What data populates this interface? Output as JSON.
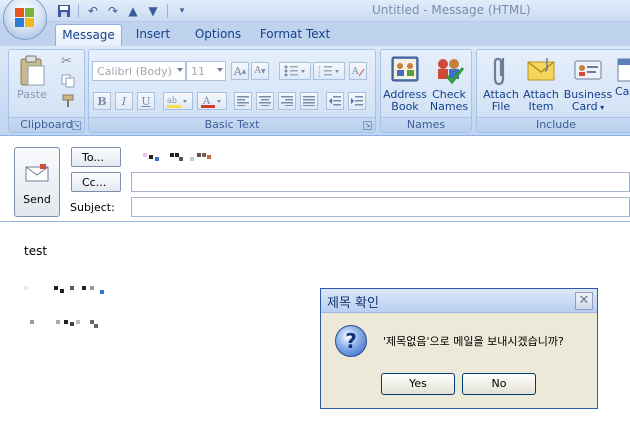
{
  "window": {
    "title": "Untitled - Message (HTML)"
  },
  "quick_access": {
    "icons": [
      "save-icon",
      "undo-icon",
      "redo-icon",
      "up-arrow-icon",
      "down-arrow-icon",
      "customize-icon"
    ]
  },
  "tabs": [
    {
      "label": "Message",
      "active": true
    },
    {
      "label": "Insert",
      "active": false
    },
    {
      "label": "Options",
      "active": false
    },
    {
      "label": "Format Text",
      "active": false
    }
  ],
  "ribbon": {
    "clipboard": {
      "label": "Clipboard",
      "paste": "Paste"
    },
    "basic_text": {
      "label": "Basic Text",
      "font": "Calibri (Body)",
      "size": "11"
    },
    "names": {
      "label": "Names",
      "address_book": [
        "Address",
        "Book"
      ],
      "check_names": [
        "Check",
        "Names"
      ]
    },
    "include": {
      "label": "Include",
      "attach_file": [
        "Attach",
        "File"
      ],
      "attach_item": [
        "Attach",
        "Item"
      ],
      "business_card": [
        "Business",
        "Card"
      ],
      "calendar_partial": "Cal"
    }
  },
  "header": {
    "send": "Send",
    "to": "To...",
    "cc": "Cc...",
    "subject_label": "Subject:"
  },
  "body": {
    "text": "test"
  },
  "dialog": {
    "title": "제목 확인",
    "message": "'제목없음'으로 메일을 보내시겠습니까?",
    "yes": "Yes",
    "no": "No"
  },
  "colors": {
    "accent": "#15428b",
    "ribbon": "#c8daf3",
    "dialog_bg": "#ece9d8"
  }
}
